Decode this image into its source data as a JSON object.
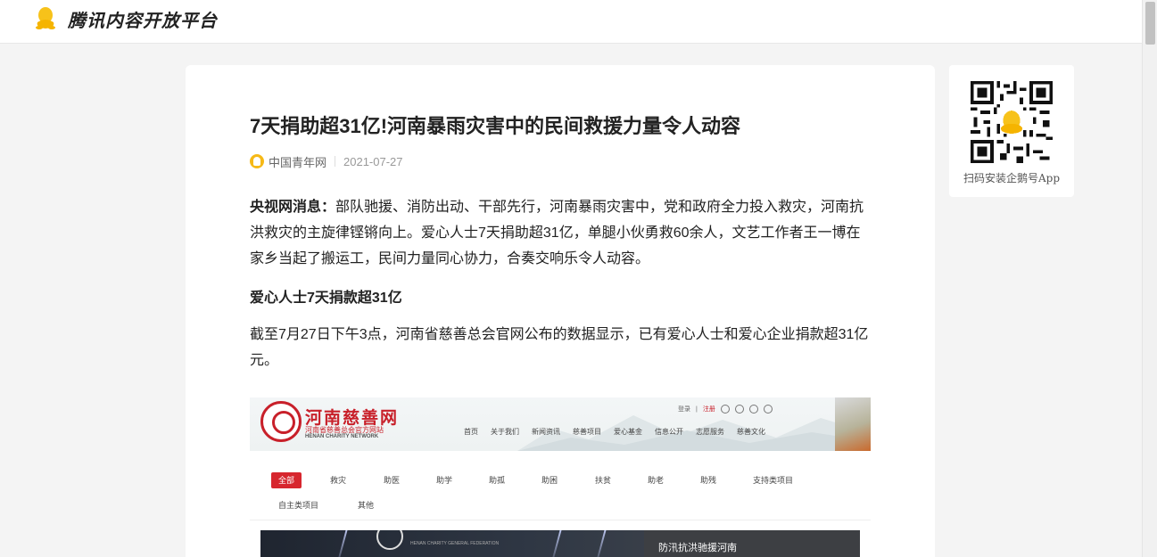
{
  "header": {
    "logo_icon": "penguin-icon",
    "brand": "腾讯内容开放平台"
  },
  "article": {
    "title": "7天捐助超31亿!河南暴雨灾害中的民间救援力量令人动容",
    "source": "中国青年网",
    "source_icon": "source-badge-icon",
    "date": "2021-07-27",
    "lead_label": "央视网消息：",
    "para1": "部队驰援、消防出动、干部先行，河南暴雨灾害中，党和政府全力投入救灾，河南抗洪救灾的主旋律铿锵向上。爱心人士7天捐助超31亿，单腿小伙勇救60余人，文艺工作者王一博在家乡当起了搬运工，民间力量同心协力，合奏交响乐令人动容。",
    "subhead": "爱心人士7天捐款超31亿",
    "para2": "截至7月27日下午3点，河南省慈善总会官网公布的数据显示，已有爱心人士和爱心企业捐款超31亿元。"
  },
  "embed": {
    "site_name": "河南慈善网",
    "site_sub": "河南省慈善总会官方网站",
    "site_en": "HENAN CHARITY NETWORK",
    "login": "登录",
    "register": "注册",
    "nav": [
      "首页",
      "关于我们",
      "新闻资讯",
      "慈善项目",
      "爱心基金",
      "信息公开",
      "志愿服务",
      "慈善文化"
    ],
    "categories_row1": [
      "全部",
      "救灾",
      "助医",
      "助学",
      "助孤",
      "助困",
      "扶贫",
      "助老",
      "助残",
      "支持类项目"
    ],
    "categories_row2": [
      "自主类项目",
      "其他"
    ],
    "banner_org_en": "HENAN CHARITY GENERAL FEDERATION",
    "banner_title": "防汛抗洪驰援河南"
  },
  "sidebar": {
    "qr_icon": "qr-code-icon",
    "qr_caption": "扫码安装企鹅号App"
  },
  "colors": {
    "accent": "#f6b917",
    "charity_red": "#c8202a",
    "page_bg": "#f4f4f4"
  }
}
